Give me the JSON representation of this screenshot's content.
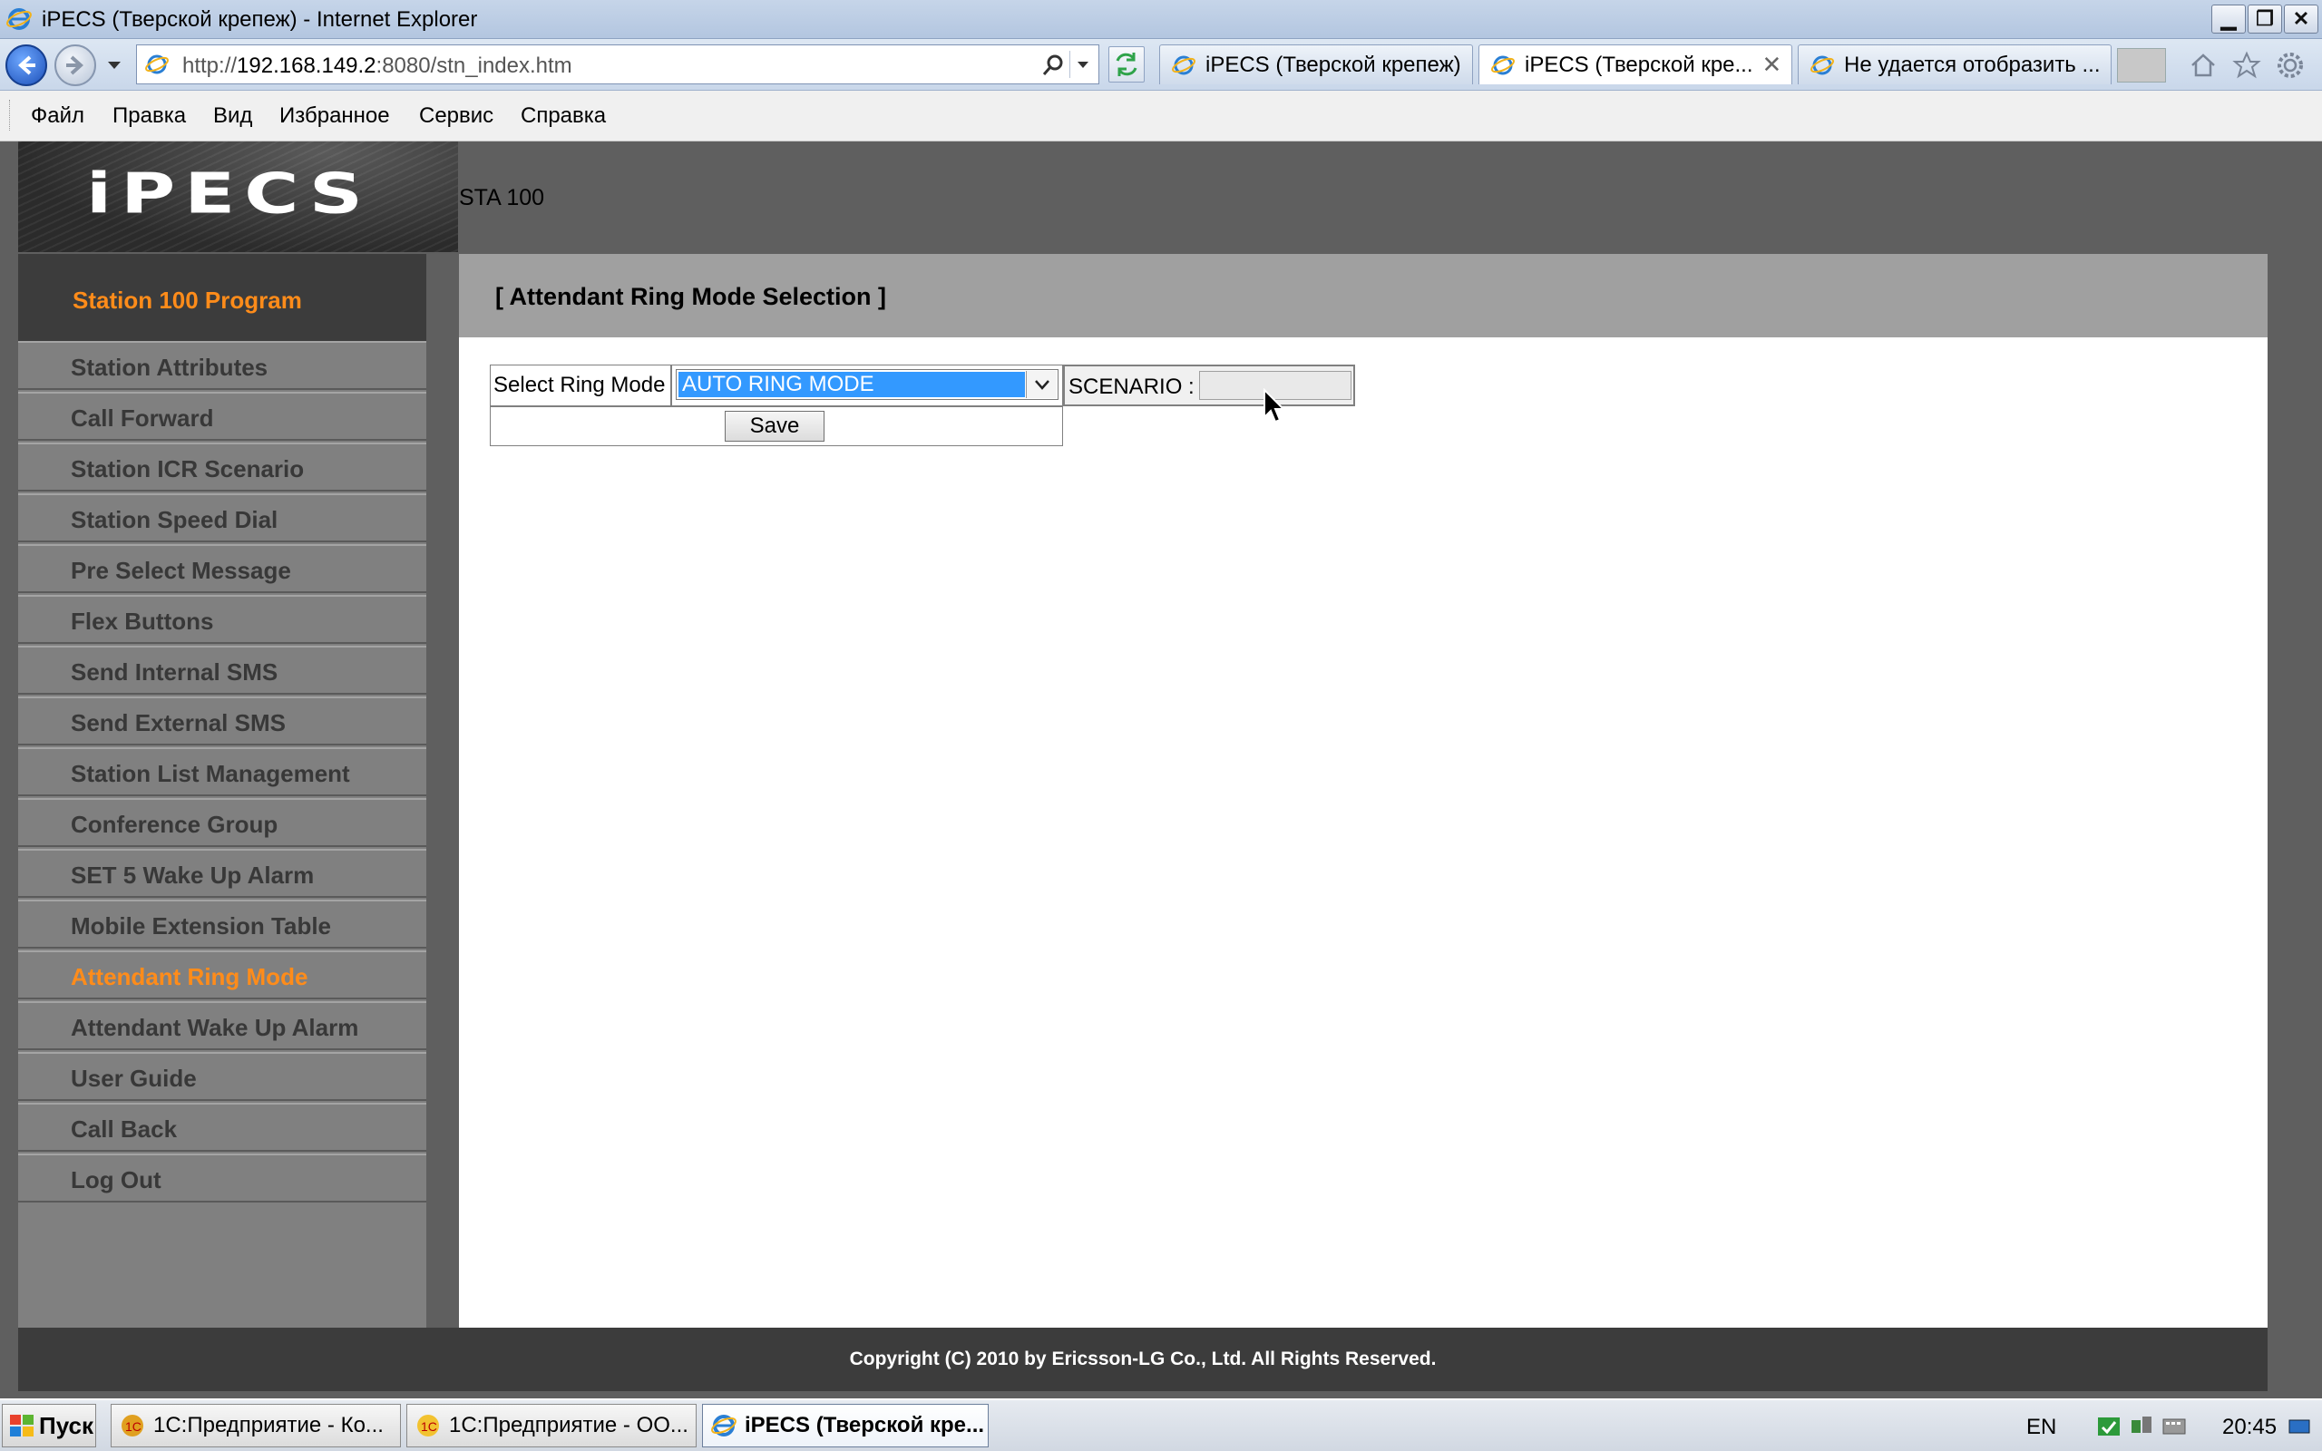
{
  "window": {
    "title": "iPECS (Тверской крепеж) - Internet Explorer",
    "minimize": "▁",
    "restore": "❐",
    "close": "✕"
  },
  "address": {
    "url_prefix": "http://",
    "url_host": "192.168.149.2",
    "url_rest": ":8080/stn_index.htm"
  },
  "tabs": [
    {
      "label": "iPECS (Тверской крепеж)"
    },
    {
      "label": "iPECS (Тверской кре...",
      "close": "✕"
    },
    {
      "label": "Не удается отобразить ..."
    }
  ],
  "menubar": [
    "Файл",
    "Правка",
    "Вид",
    "Избранное",
    "Сервис",
    "Справка"
  ],
  "page": {
    "logo": "iPECS",
    "station_label": "STA 100",
    "sidebar_title": "Station 100 Program",
    "sidebar_items": [
      {
        "label": "Station Attributes",
        "active": false
      },
      {
        "label": "Call Forward",
        "active": false
      },
      {
        "label": "Station ICR Scenario",
        "active": false
      },
      {
        "label": "Station Speed Dial",
        "active": false
      },
      {
        "label": "Pre Select Message",
        "active": false
      },
      {
        "label": "Flex Buttons",
        "active": false
      },
      {
        "label": "Send Internal SMS",
        "active": false
      },
      {
        "label": "Send External SMS",
        "active": false
      },
      {
        "label": "Station List Management",
        "active": false
      },
      {
        "label": "Conference Group",
        "active": false
      },
      {
        "label": "SET 5 Wake Up Alarm",
        "active": false
      },
      {
        "label": "Mobile Extension Table",
        "active": false
      },
      {
        "label": "Attendant Ring Mode",
        "active": true
      },
      {
        "label": "Attendant Wake Up Alarm",
        "active": false
      },
      {
        "label": "User Guide",
        "active": false
      },
      {
        "label": "Call Back",
        "active": false
      },
      {
        "label": "Log Out",
        "active": false
      }
    ],
    "content_title": "[ Attendant Ring Mode Selection ]",
    "form": {
      "ring_mode_label": "Select Ring Mode",
      "ring_mode_value": "AUTO RING MODE",
      "scenario_label": "SCENARIO :",
      "scenario_value": "",
      "save_label": "Save"
    },
    "footer": "Copyright (C) 2010 by Ericsson-LG Co., Ltd. All Rights Reserved."
  },
  "taskbar": {
    "start_label": "Пуск",
    "tasks": [
      {
        "label": "1С:Предприятие - Ко...",
        "active": false
      },
      {
        "label": "1С:Предприятие - ОО...",
        "active": false
      },
      {
        "label": "iPECS (Тверской кре...",
        "active": true
      }
    ],
    "language": "EN",
    "clock": "20:45"
  },
  "colors": {
    "accent_orange": "#ff8c1a",
    "selection_blue": "#3399ff",
    "page_gray": "#5f5f5f",
    "dark_bar": "#3c3c3c"
  }
}
